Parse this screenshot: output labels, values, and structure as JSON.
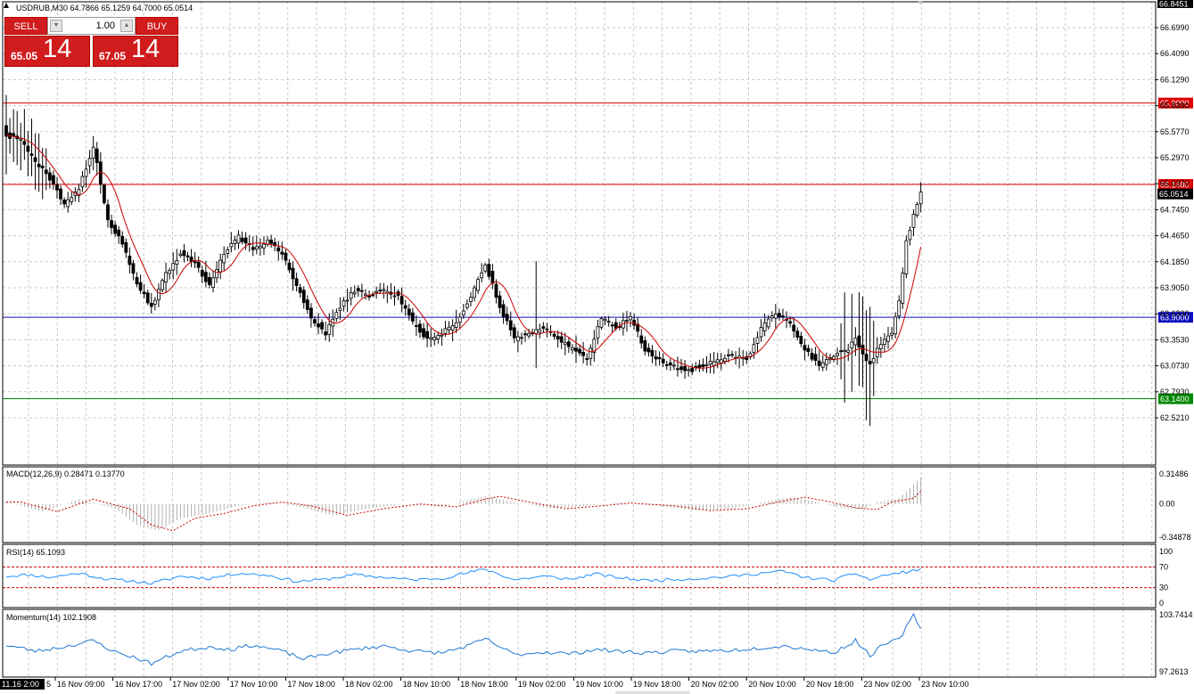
{
  "header": {
    "symbol_info": "USDRUB,M30  64.7866 65.1259 64.7000 65.0514"
  },
  "trade_panel": {
    "sell_label": "SELL",
    "buy_label": "BUY",
    "lot_value": "1.00",
    "sell_price_small": "65.05",
    "sell_price_big": "14",
    "buy_price_small": "67.05",
    "buy_price_big": "14"
  },
  "price_axis": {
    "top_value": "66.8451",
    "labels": [
      "66.6990",
      "66.4090",
      "66.1290",
      "65.8390",
      "65.5770",
      "65.2970",
      "65.0370",
      "64.7450",
      "64.4650",
      "64.1850",
      "63.9050",
      "63.6330",
      "63.3530",
      "63.0730",
      "62.7930",
      "62.5210"
    ],
    "current_price": "65.0514"
  },
  "horizontal_lines": [
    {
      "price": 65.9,
      "label": "65.9000",
      "color": "#dd0000"
    },
    {
      "price": 65.14,
      "label": "65.1400",
      "color": "#dd0000"
    },
    {
      "price": 63.9,
      "label": "63.9000",
      "color": "#1010c0"
    },
    {
      "price": 63.14,
      "label": "63.1400",
      "color": "#008800"
    }
  ],
  "indicators": {
    "macd": {
      "label": "MACD(12,26,9) 0.28471 0.13770",
      "axis": [
        "0.31486",
        "0.00",
        "-0.34878"
      ]
    },
    "rsi": {
      "label": "RSI(14) 65.1093",
      "axis": [
        "100",
        "70",
        "30",
        "0"
      ]
    },
    "momentum": {
      "label": "Momentum(14) 102.1908",
      "axis": [
        "103.7414",
        "97.2613"
      ]
    }
  },
  "time_axis": {
    "first_label": "11.16 2:00",
    "labels": [
      "16 Nov 09:00",
      "16 Nov 17:00",
      "17 Nov 02:00",
      "17 Nov 10:00",
      "17 Nov 18:00",
      "18 Nov 02:00",
      "18 Nov 10:00",
      "18 Nov 18:00",
      "19 Nov 02:00",
      "19 Nov 10:00",
      "19 Nov 18:00",
      "20 Nov 02:00",
      "20 Nov 10:00",
      "20 Nov 18:00",
      "23 Nov 02:00",
      "23 Nov 10:00"
    ]
  },
  "chart_data": {
    "type": "candlestick",
    "symbol": "USDRUB",
    "timeframe": "M30",
    "ylim": [
      62.521,
      66.8451
    ],
    "anchors": [
      [
        0,
        65.6
      ],
      [
        4,
        65.55
      ],
      [
        8,
        65.35
      ],
      [
        12,
        65.2
      ],
      [
        16,
        64.95
      ],
      [
        20,
        65.1
      ],
      [
        24,
        65.5
      ],
      [
        28,
        64.8
      ],
      [
        32,
        64.6
      ],
      [
        36,
        64.2
      ],
      [
        40,
        64.0
      ],
      [
        44,
        64.3
      ],
      [
        48,
        64.5
      ],
      [
        52,
        64.4
      ],
      [
        56,
        64.2
      ],
      [
        60,
        64.5
      ],
      [
        64,
        64.65
      ],
      [
        68,
        64.55
      ],
      [
        72,
        64.6
      ],
      [
        76,
        64.5
      ],
      [
        80,
        64.2
      ],
      [
        84,
        63.9
      ],
      [
        88,
        63.75
      ],
      [
        92,
        64.0
      ],
      [
        96,
        64.15
      ],
      [
        100,
        64.1
      ],
      [
        104,
        64.15
      ],
      [
        108,
        64.1
      ],
      [
        112,
        63.85
      ],
      [
        116,
        63.7
      ],
      [
        120,
        63.75
      ],
      [
        124,
        63.85
      ],
      [
        128,
        64.1
      ],
      [
        132,
        64.4
      ],
      [
        136,
        64.0
      ],
      [
        140,
        63.7
      ],
      [
        144,
        63.75
      ],
      [
        148,
        63.8
      ],
      [
        152,
        63.7
      ],
      [
        156,
        63.6
      ],
      [
        160,
        63.5
      ],
      [
        164,
        63.9
      ],
      [
        168,
        63.8
      ],
      [
        172,
        63.9
      ],
      [
        176,
        63.6
      ],
      [
        180,
        63.5
      ],
      [
        184,
        63.45
      ],
      [
        188,
        63.4
      ],
      [
        192,
        63.45
      ],
      [
        196,
        63.5
      ],
      [
        200,
        63.55
      ],
      [
        204,
        63.5
      ],
      [
        208,
        63.8
      ],
      [
        212,
        63.95
      ],
      [
        216,
        63.85
      ],
      [
        220,
        63.6
      ],
      [
        224,
        63.45
      ],
      [
        228,
        63.55
      ],
      [
        232,
        63.6
      ],
      [
        234,
        63.7
      ],
      [
        236,
        63.55
      ],
      [
        238,
        63.45
      ],
      [
        240,
        63.6
      ],
      [
        242,
        63.7
      ],
      [
        244,
        63.75
      ],
      [
        246,
        64.05
      ],
      [
        248,
        64.6
      ],
      [
        250,
        64.85
      ],
      [
        252,
        65.05
      ]
    ],
    "macd_anchors": [
      [
        0,
        0.02
      ],
      [
        10,
        -0.08
      ],
      [
        20,
        0.05
      ],
      [
        30,
        -0.05
      ],
      [
        36,
        -0.22
      ],
      [
        42,
        -0.28
      ],
      [
        48,
        -0.15
      ],
      [
        56,
        -0.1
      ],
      [
        64,
        -0.02
      ],
      [
        72,
        0.02
      ],
      [
        80,
        -0.02
      ],
      [
        90,
        -0.12
      ],
      [
        100,
        -0.05
      ],
      [
        110,
        0.0
      ],
      [
        120,
        -0.03
      ],
      [
        128,
        0.05
      ],
      [
        132,
        0.08
      ],
      [
        140,
        0.02
      ],
      [
        150,
        -0.05
      ],
      [
        160,
        -0.02
      ],
      [
        168,
        0.01
      ],
      [
        180,
        -0.02
      ],
      [
        190,
        -0.07
      ],
      [
        200,
        -0.05
      ],
      [
        210,
        0.03
      ],
      [
        216,
        0.07
      ],
      [
        222,
        0.03
      ],
      [
        230,
        -0.04
      ],
      [
        236,
        -0.06
      ],
      [
        240,
        0.02
      ],
      [
        246,
        0.06
      ],
      [
        252,
        0.28
      ]
    ],
    "rsi_anchors": [
      [
        0,
        52
      ],
      [
        6,
        55
      ],
      [
        12,
        50
      ],
      [
        20,
        58
      ],
      [
        28,
        46
      ],
      [
        36,
        42
      ],
      [
        40,
        38
      ],
      [
        48,
        52
      ],
      [
        56,
        48
      ],
      [
        64,
        58
      ],
      [
        72,
        54
      ],
      [
        80,
        42
      ],
      [
        88,
        46
      ],
      [
        96,
        55
      ],
      [
        104,
        50
      ],
      [
        112,
        45
      ],
      [
        120,
        48
      ],
      [
        128,
        60
      ],
      [
        132,
        66
      ],
      [
        140,
        45
      ],
      [
        148,
        52
      ],
      [
        156,
        46
      ],
      [
        162,
        57
      ],
      [
        168,
        50
      ],
      [
        176,
        44
      ],
      [
        184,
        46
      ],
      [
        192,
        48
      ],
      [
        200,
        52
      ],
      [
        208,
        58
      ],
      [
        214,
        62
      ],
      [
        220,
        50
      ],
      [
        228,
        44
      ],
      [
        234,
        58
      ],
      [
        238,
        45
      ],
      [
        242,
        54
      ],
      [
        246,
        58
      ],
      [
        252,
        65.11
      ]
    ],
    "momentum_anchors": [
      [
        0,
        100.3
      ],
      [
        8,
        99.6
      ],
      [
        16,
        100.1
      ],
      [
        24,
        100.8
      ],
      [
        30,
        99.5
      ],
      [
        36,
        98.8
      ],
      [
        40,
        98.2
      ],
      [
        48,
        99.6
      ],
      [
        56,
        100.1
      ],
      [
        62,
        99.8
      ],
      [
        68,
        100.3
      ],
      [
        76,
        99.6
      ],
      [
        82,
        98.7
      ],
      [
        88,
        99.3
      ],
      [
        96,
        99.8
      ],
      [
        104,
        100.2
      ],
      [
        112,
        99.6
      ],
      [
        120,
        99.4
      ],
      [
        128,
        100.3
      ],
      [
        132,
        101.0
      ],
      [
        140,
        99.2
      ],
      [
        148,
        99.5
      ],
      [
        156,
        99.3
      ],
      [
        162,
        99.8
      ],
      [
        168,
        99.6
      ],
      [
        176,
        99.4
      ],
      [
        184,
        99.6
      ],
      [
        192,
        99.6
      ],
      [
        200,
        99.7
      ],
      [
        208,
        100.0
      ],
      [
        214,
        100.2
      ],
      [
        222,
        99.8
      ],
      [
        228,
        99.4
      ],
      [
        234,
        100.8
      ],
      [
        238,
        99.1
      ],
      [
        242,
        100.4
      ],
      [
        246,
        100.9
      ],
      [
        250,
        103.7
      ],
      [
        252,
        102.19
      ]
    ]
  },
  "colors": {
    "bull_candle": "#ffffff",
    "bear_candle": "#000000",
    "ma_line": "#cc0000",
    "rsi_line": "#1e90ff",
    "momentum_line": "#1e78d2",
    "macd_signal": "#cc0000",
    "macd_hist": "#b0b0b0",
    "grid": "#c8c8c8",
    "sell_button": "#d01c1c",
    "buy_button": "#d01c1c"
  }
}
